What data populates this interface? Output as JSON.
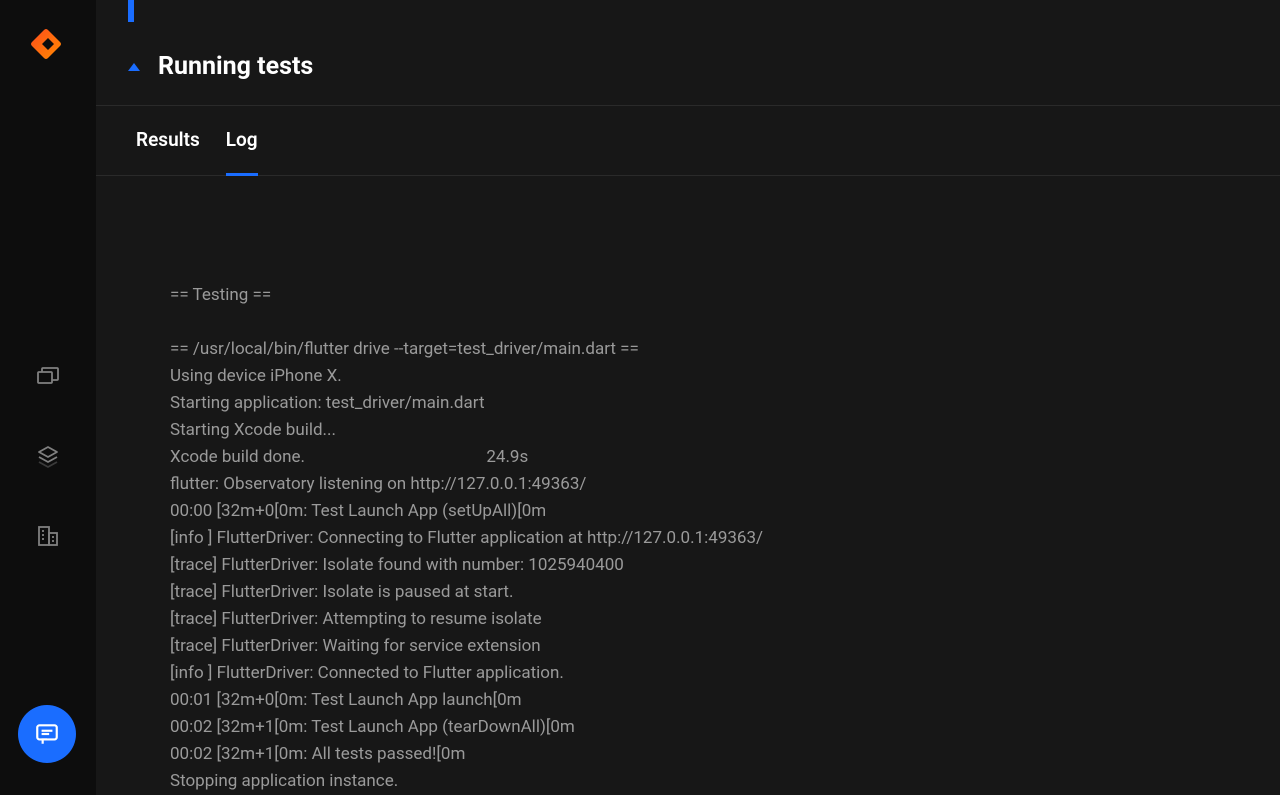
{
  "section": {
    "title": "Running tests"
  },
  "tabs": {
    "results": "Results",
    "log": "Log"
  },
  "log_lines": [
    "== Testing ==",
    "",
    "== /usr/local/bin/flutter drive --target=test_driver/main.dart ==",
    "Using device iPhone X.",
    "Starting application: test_driver/main.dart",
    "Starting Xcode build...",
    "Xcode build done.                                           24.9s",
    "flutter: Observatory listening on http://127.0.0.1:49363/",
    "00:00 [32m+0[0m: Test Launch App (setUpAll)[0m",
    "[info ] FlutterDriver: Connecting to Flutter application at http://127.0.0.1:49363/",
    "[trace] FlutterDriver: Isolate found with number: 1025940400",
    "[trace] FlutterDriver: Isolate is paused at start.",
    "[trace] FlutterDriver: Attempting to resume isolate",
    "[trace] FlutterDriver: Waiting for service extension",
    "[info ] FlutterDriver: Connected to Flutter application.",
    "00:01 [32m+0[0m: Test Launch App launch[0m",
    "00:02 [32m+1[0m: Test Launch App (tearDownAll)[0m",
    "00:02 [32m+1[0m: All tests passed![0m",
    "Stopping application instance."
  ]
}
